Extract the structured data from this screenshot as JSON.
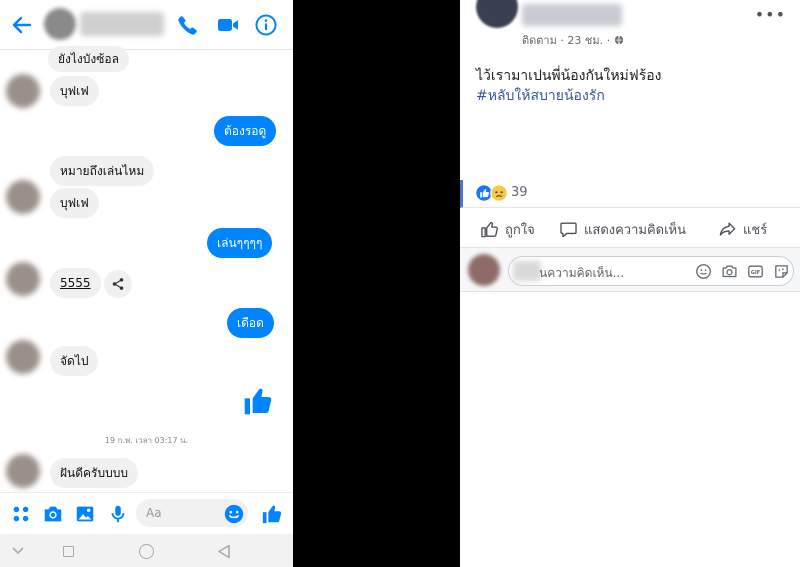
{
  "messenger": {
    "composer_placeholder": "Aa",
    "messages": [
      {
        "dir": "in",
        "text": "ยังไงบังซ้อล"
      },
      {
        "dir": "in",
        "text": "บุฟเฟ"
      },
      {
        "dir": "out",
        "text": "ต้องรอดู"
      },
      {
        "dir": "in",
        "text": "หมายถึงเล่นไหม"
      },
      {
        "dir": "in",
        "text": "บุฟเฟ"
      },
      {
        "dir": "out",
        "text": "เล่นๆๆๆๆ"
      },
      {
        "dir": "in",
        "text": "5555"
      },
      {
        "dir": "out",
        "text": "เดือด"
      },
      {
        "dir": "in",
        "text": "จัดไป"
      },
      {
        "dir": "in",
        "text": "ฝันดีครับบบบ"
      }
    ],
    "timestamp": "19 ก.พ. เวลา 03:17 น.",
    "colors": {
      "accent": "#0084ff",
      "incoming_bg": "#f0f0f0"
    }
  },
  "facebook_post": {
    "follow_label": "ติดตาม",
    "time": "23 ชม.",
    "more": "•••",
    "text": "ไว้เรามาเปนพี่น้องกันใหม่ฟร้อง",
    "hashtag": "#หลับให้สบายน้องรัก",
    "reaction_count": "39",
    "actions": {
      "like": "ถูกใจ",
      "comment": "แสดงความคิดเห็น",
      "share": "แชร์"
    },
    "comment_placeholder": "นความคิดเห็น...",
    "colors": {
      "link": "#385898",
      "like_blue": "#1877f2"
    }
  }
}
